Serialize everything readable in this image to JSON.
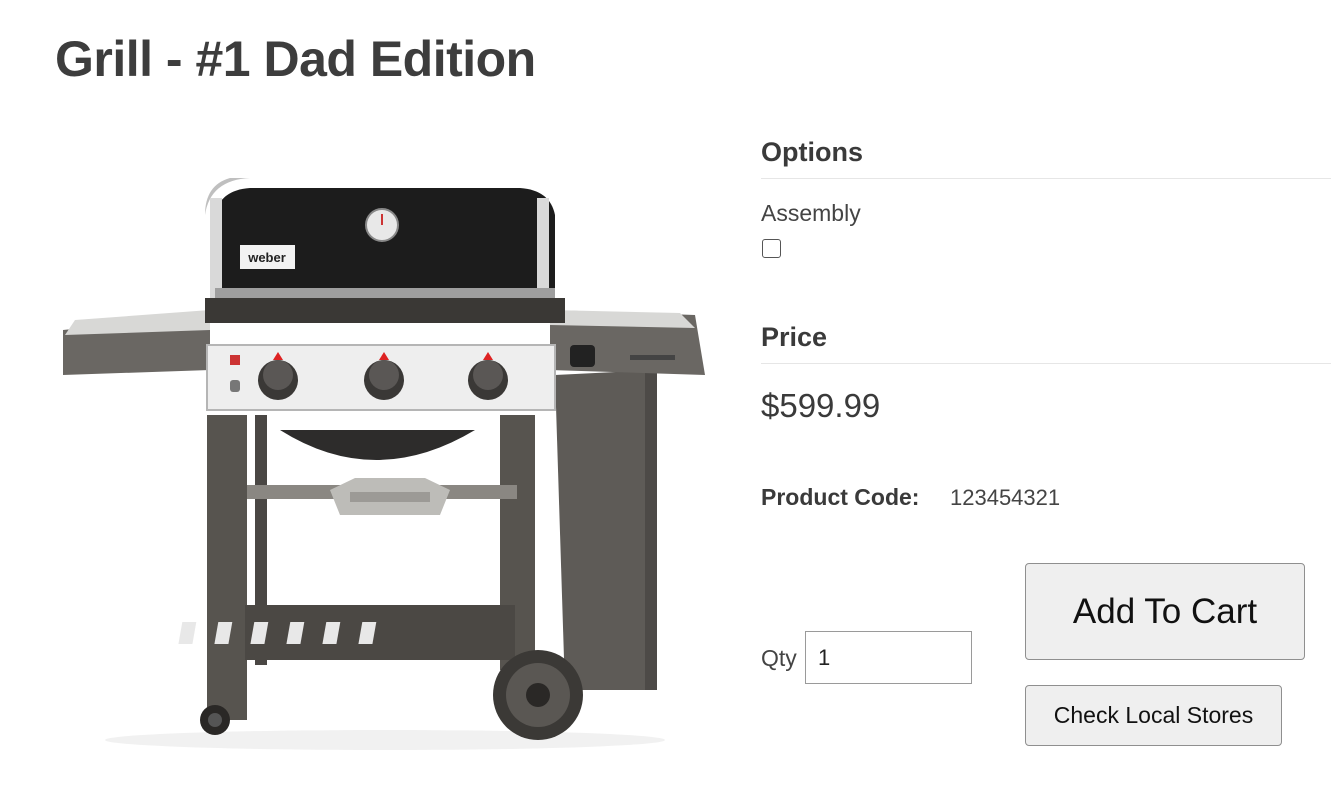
{
  "product": {
    "title": "Grill - #1 Dad Edition",
    "brand_logo_text": "weber"
  },
  "options": {
    "heading": "Options",
    "items": [
      {
        "label": "Assembly",
        "checked": false
      }
    ]
  },
  "price": {
    "heading": "Price",
    "value": "$599.99"
  },
  "product_code": {
    "label": "Product Code:",
    "value": "123454321"
  },
  "quantity": {
    "label": "Qty",
    "value": "1"
  },
  "buttons": {
    "add_to_cart": "Add To Cart",
    "check_stores": "Check Local Stores"
  },
  "colors": {
    "heading_text": "#3d3d3d",
    "button_bg": "#efefef",
    "button_border": "#8f8f8f",
    "divider": "#e6e6e6"
  }
}
